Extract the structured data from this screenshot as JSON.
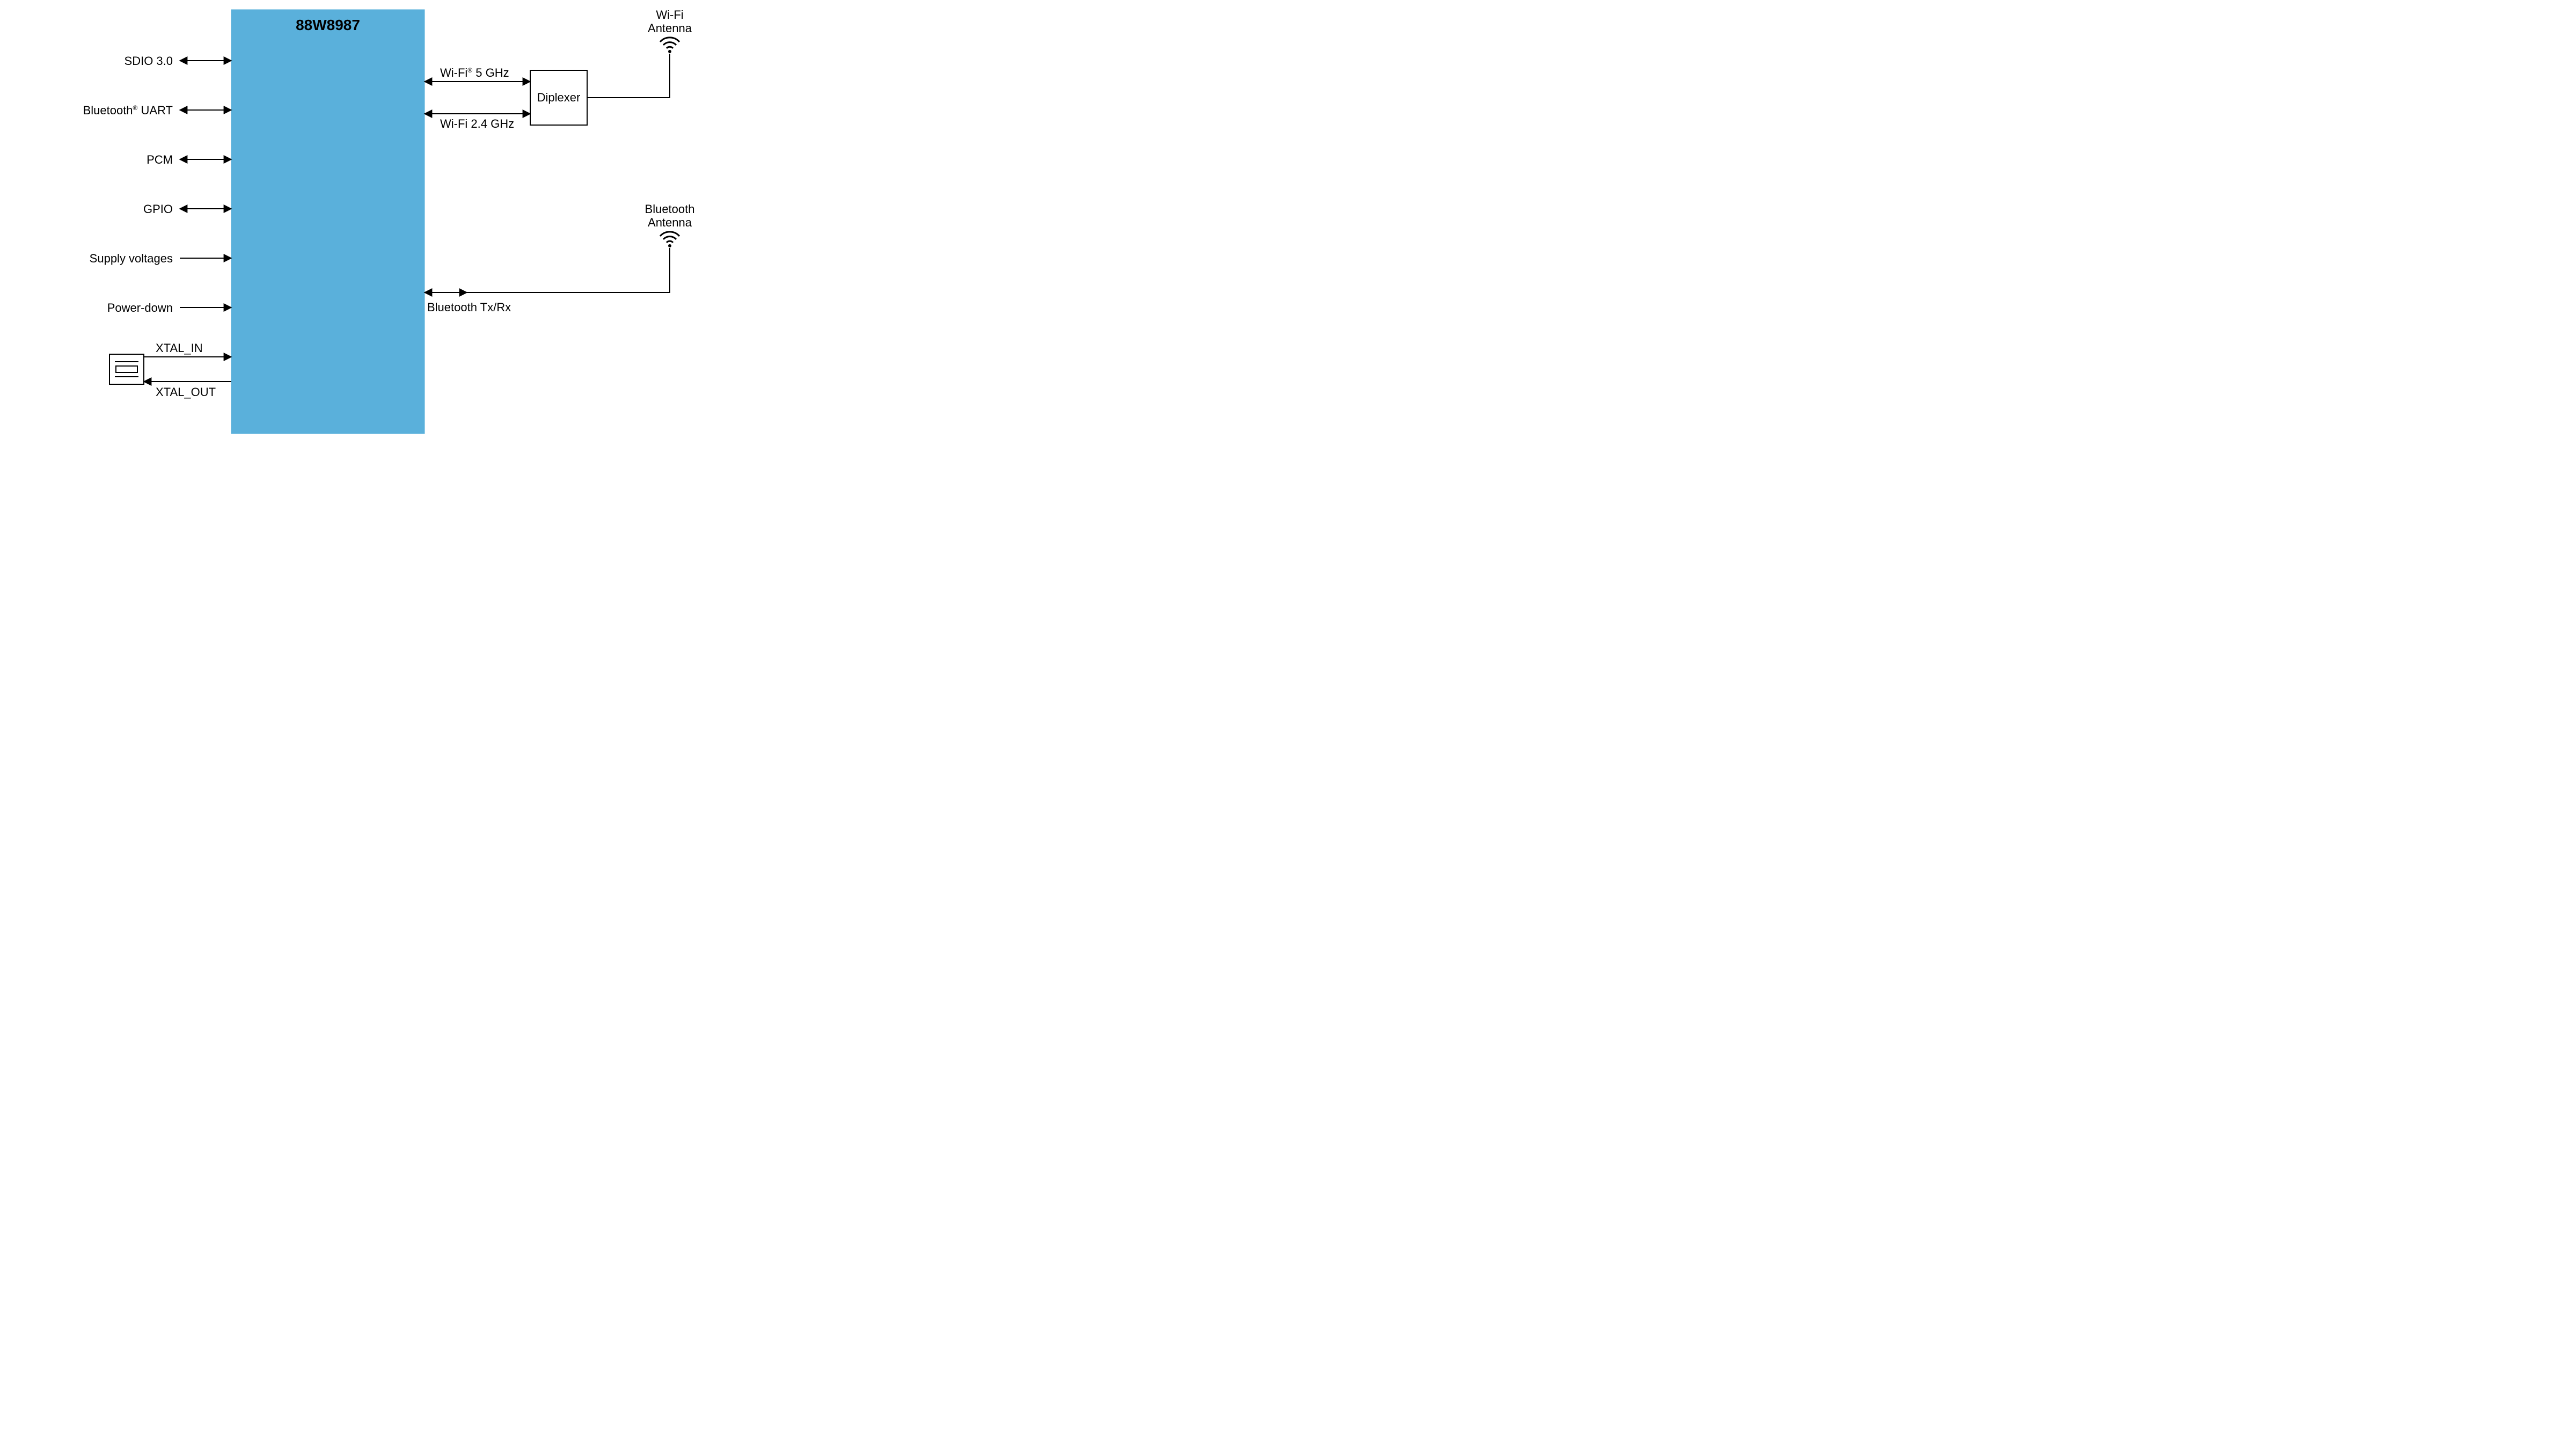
{
  "chip": {
    "title": "88W8987"
  },
  "left": {
    "sdio": "SDIO 3.0",
    "bt_uart_pre": "Bluetooth",
    "bt_uart_post": " UART",
    "pcm": "PCM",
    "gpio": "GPIO",
    "supply": "Supply voltages",
    "pdown": "Power-down",
    "xtal_in": "XTAL_IN",
    "xtal_out": "XTAL_OUT"
  },
  "right": {
    "wifi5_pre": "Wi-Fi",
    "wifi5_post": " 5 GHz",
    "wifi24": "Wi-Fi 2.4 GHz",
    "bt_txrx": "Bluetooth Tx/Rx",
    "diplexer": "Diplexer"
  },
  "antennas": {
    "wifi_l1": "Wi-Fi",
    "wifi_l2": "Antenna",
    "bt_l1": "Bluetooth",
    "bt_l2": "Antenna"
  }
}
